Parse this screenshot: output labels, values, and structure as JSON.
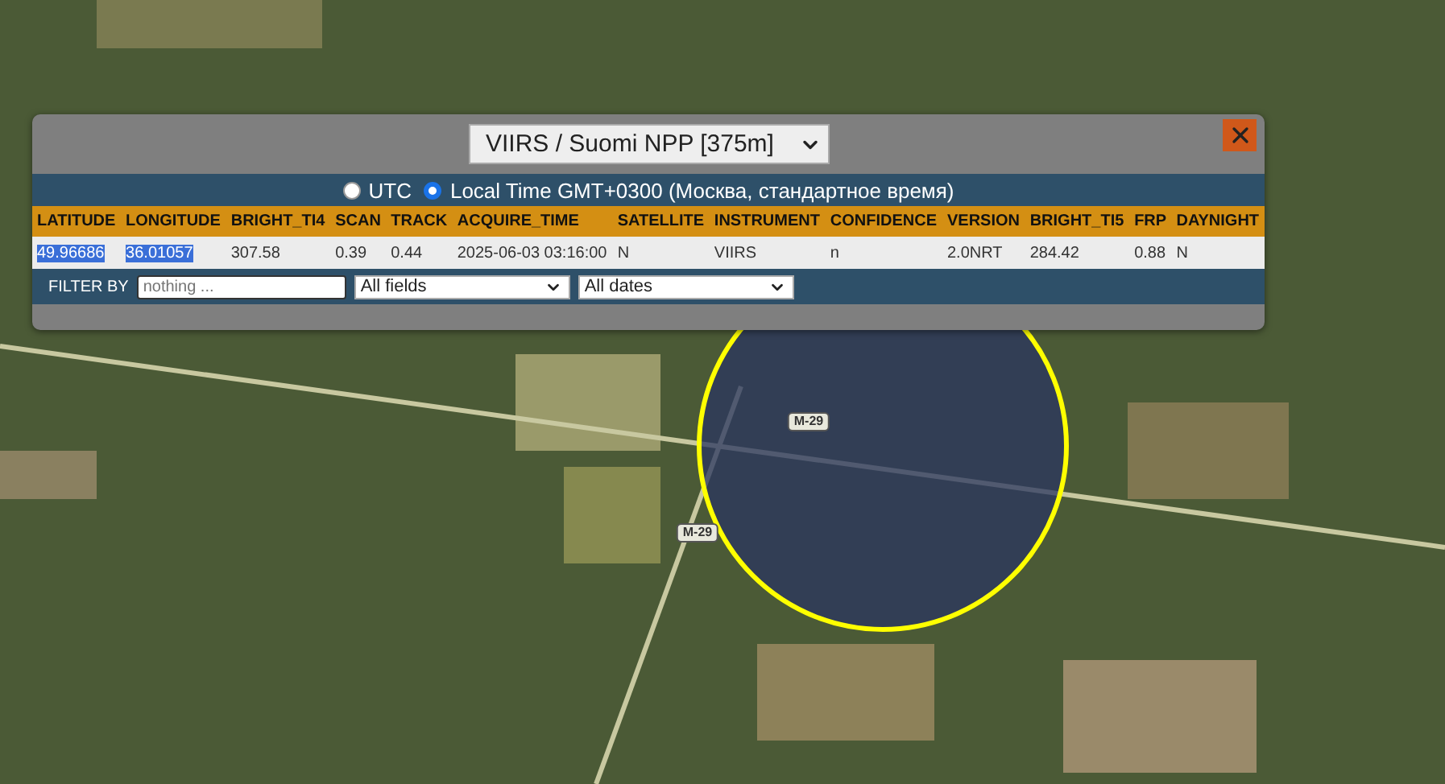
{
  "map": {
    "road_labels": [
      "M-29",
      "M-29"
    ]
  },
  "panel": {
    "source_select": {
      "value": "VIIRS / Suomi NPP [375m]"
    },
    "time_modes": [
      {
        "label": "UTC",
        "selected": false
      },
      {
        "label": "Local Time GMT+0300 (Москва, стандартное время)",
        "selected": true
      }
    ],
    "table": {
      "columns": [
        "LATITUDE",
        "LONGITUDE",
        "BRIGHT_TI4",
        "SCAN",
        "TRACK",
        "ACQUIRE_TIME",
        "SATELLITE",
        "INSTRUMENT",
        "CONFIDENCE",
        "VERSION",
        "BRIGHT_TI5",
        "FRP",
        "DAYNIGHT"
      ],
      "rows": [
        {
          "cells": [
            {
              "text": "49.96686",
              "highlighted": true
            },
            {
              "text": "36.01057",
              "highlighted": true
            },
            {
              "text": "307.58",
              "highlighted": false
            },
            {
              "text": "0.39",
              "highlighted": false
            },
            {
              "text": "0.44",
              "highlighted": false
            },
            {
              "text": "2025-06-03 03:16:00",
              "highlighted": false
            },
            {
              "text": "N",
              "highlighted": false
            },
            {
              "text": "VIIRS",
              "highlighted": false
            },
            {
              "text": "n",
              "highlighted": false
            },
            {
              "text": "2.0NRT",
              "highlighted": false
            },
            {
              "text": "284.42",
              "highlighted": false
            },
            {
              "text": "0.88",
              "highlighted": false
            },
            {
              "text": "N",
              "highlighted": false
            }
          ]
        }
      ]
    },
    "filter": {
      "label": "FILTER BY",
      "placeholder": "nothing ...",
      "field_select": "All fields",
      "date_select": "All dates"
    }
  }
}
